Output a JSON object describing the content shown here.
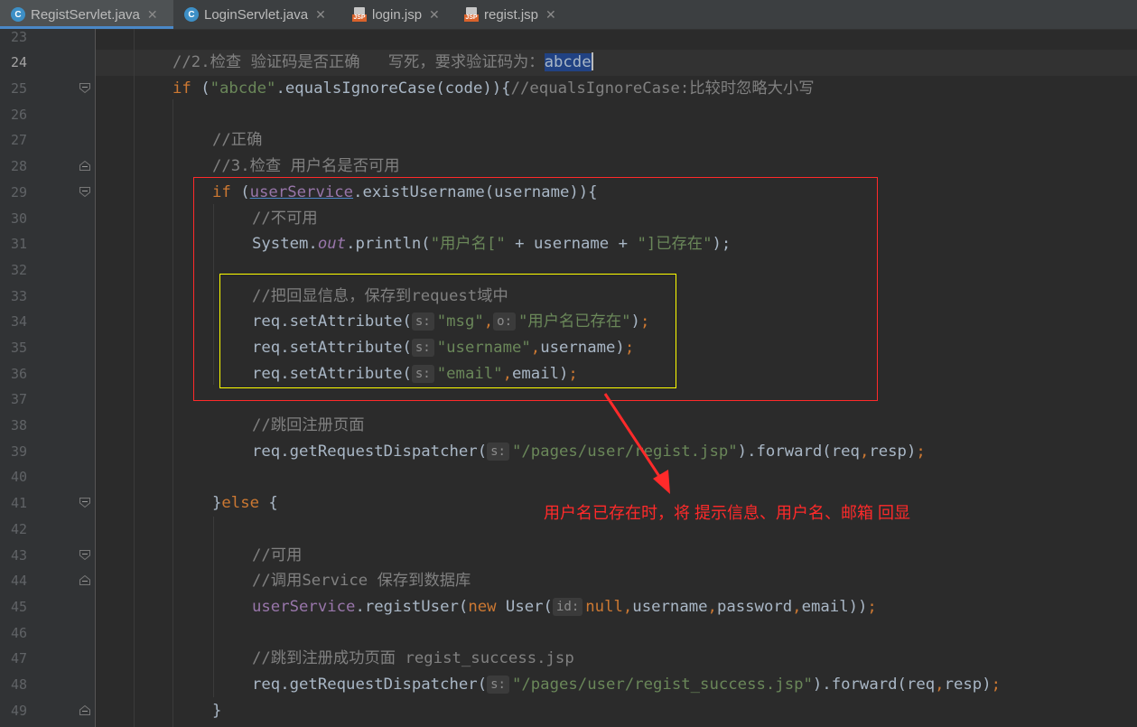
{
  "tabs": [
    {
      "label": "RegistServlet.java",
      "icon": "java-class-icon",
      "active": true
    },
    {
      "label": "LoginServlet.java",
      "icon": "java-class-icon",
      "active": false
    },
    {
      "label": "login.jsp",
      "icon": "jsp-file-icon",
      "active": false
    },
    {
      "label": "regist.jsp",
      "icon": "jsp-file-icon",
      "active": false
    }
  ],
  "colors": {
    "keyword": "#cc7832",
    "string": "#6a8759",
    "comment": "#808080",
    "field": "#9876aa",
    "text": "#a9b7c6",
    "annotation": "#ff2a2a",
    "highlight_box": "#ffff00"
  },
  "editor": {
    "current_line": 24,
    "line_numbers": [
      "23",
      "24",
      "25",
      "26",
      "27",
      "28",
      "29",
      "30",
      "31",
      "32",
      "33",
      "34",
      "35",
      "36",
      "37",
      "38",
      "39",
      "40",
      "41",
      "42",
      "43",
      "44",
      "45",
      "46",
      "47",
      "48",
      "49"
    ],
    "lines": {
      "l24": {
        "comment": "//2.检查 验证码是否正确   写死，要求验证码为：",
        "selected": "abcde"
      },
      "l25": {
        "kw_if": "if",
        "p1": " (",
        "str": "\"abcde\"",
        "p2": ".equalsIgnoreCase(code)){",
        "comment": "//equalsIgnoreCase:比较时忽略大小写"
      },
      "l27": {
        "comment": "//正确"
      },
      "l28": {
        "comment": "//3.检查 用户名是否可用"
      },
      "l29": {
        "kw_if": "if",
        "p1": " (",
        "field": "userService",
        "p2": ".existUsername(username)){"
      },
      "l30": {
        "comment": "//不可用"
      },
      "l31": {
        "p1": "System.",
        "field": "out",
        "p2": ".println(",
        "str1": "\"用户名[\"",
        "p3": " + username + ",
        "str2": "\"]已存在\"",
        "p4": ");"
      },
      "l33": {
        "comment": "//把回显信息，保存到request域中"
      },
      "l34": {
        "p1": "req.setAttribute(",
        "hint1": "s:",
        "str1": "\"msg\"",
        "comma": ",",
        "hint2": "o:",
        "str2": "\"用户名已存在\"",
        "p2": ")",
        "semi": ";"
      },
      "l35": {
        "p1": "req.setAttribute(",
        "hint": "s:",
        "str": "\"username\"",
        "comma": ",",
        "p2": "username)",
        "semi": ";"
      },
      "l36": {
        "p1": "req.setAttribute(",
        "hint": "s:",
        "str": "\"email\"",
        "comma": ",",
        "p2": "email)",
        "semi": ";"
      },
      "l38": {
        "comment": "//跳回注册页面"
      },
      "l39": {
        "p1": "req.getRequestDispatcher(",
        "hint": "s:",
        "str": "\"/pages/user/regist.jsp\"",
        "p2": ").forward(req",
        "comma": ",",
        "p3": "resp)",
        "semi": ";"
      },
      "l41": {
        "p1": "}",
        "kw_else": "else",
        "p2": " {"
      },
      "l43": {
        "comment": "//可用"
      },
      "l44": {
        "comment": "//调用Service 保存到数据库"
      },
      "l45": {
        "field": "userService",
        "p1": ".registUser(",
        "kw_new": "new",
        "p2": " User(",
        "hint": "id:",
        "kw_null": "null",
        "comma": ",",
        "p3": "username",
        "comma2": ",",
        "p4": "password",
        "comma3": ",",
        "p5": "email))",
        "semi": ";"
      },
      "l47": {
        "comment": "//跳到注册成功页面 regist_success.jsp"
      },
      "l48": {
        "p1": "req.getRequestDispatcher(",
        "hint": "s:",
        "str": "\"/pages/user/regist_success.jsp\"",
        "p2": ").forward(req",
        "comma": ",",
        "p3": "resp)",
        "semi": ";"
      },
      "l49": {
        "p1": "}"
      }
    }
  },
  "annotation": {
    "text": "用户名已存在时，将 提示信息、用户名、邮箱 回显"
  }
}
